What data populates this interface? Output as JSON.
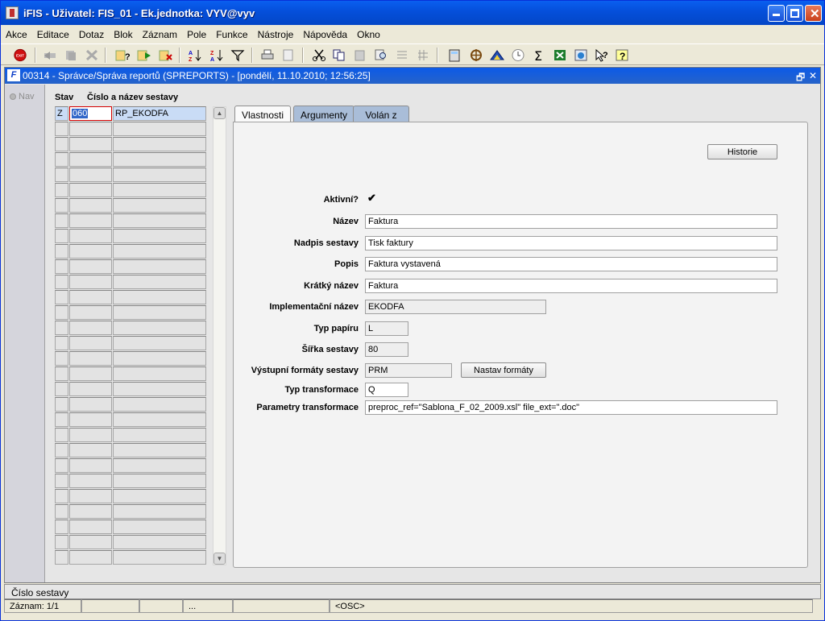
{
  "window": {
    "title": "iFIS - Uživatel: FIS_01 - Ek.jednotka: VYV@vyv"
  },
  "menu": [
    "Akce",
    "Editace",
    "Dotaz",
    "Blok",
    "Záznam",
    "Pole",
    "Funkce",
    "Nástroje",
    "Nápověda",
    "Okno"
  ],
  "toolbar": {
    "exit_label": "EXIT"
  },
  "form": {
    "title": "00314 - Správce/Správa reportů (SPREPORTS) - [pondělí, 11.10.2010; 12:56:25]",
    "nav_label": "Nav",
    "list": {
      "header_stav": "Stav",
      "header_cislo": "Číslo a název sestavy",
      "first_row": {
        "stav": "Z",
        "cislo": "060",
        "nazev": "RP_EKODFA"
      }
    },
    "tabs": [
      "Vlastnosti",
      "Argumenty",
      "Volán z"
    ],
    "historie_button": "Historie",
    "fields": {
      "aktivni_label": "Aktivní?",
      "nazev_label": "Název",
      "nazev_value": "Faktura",
      "nadpis_label": "Nadpis sestavy",
      "nadpis_value": "Tisk faktury",
      "popis_label": "Popis",
      "popis_value": "Faktura vystavená",
      "kratky_label": "Krátký název",
      "kratky_value": "Faktura",
      "impl_label": "Implementační název",
      "impl_value": "EKODFA",
      "typ_papiru_label": "Typ papíru",
      "typ_papiru_value": "L",
      "sirka_label": "Šířka sestavy",
      "sirka_value": "80",
      "vystupni_label": "Výstupní formáty sestavy",
      "vystupni_value": "PRM",
      "nastav_button": "Nastav formáty",
      "typ_transf_label": "Typ transformace",
      "typ_transf_value": "Q",
      "param_label": "Parametry transformace",
      "param_value": "preproc_ref=\"Sablona_F_02_2009.xsl\" file_ext=\".doc\""
    }
  },
  "status": {
    "field_name": "Číslo sestavy",
    "record": "Záznam: 1/1",
    "dots": "...",
    "mode": "<OSC>"
  }
}
